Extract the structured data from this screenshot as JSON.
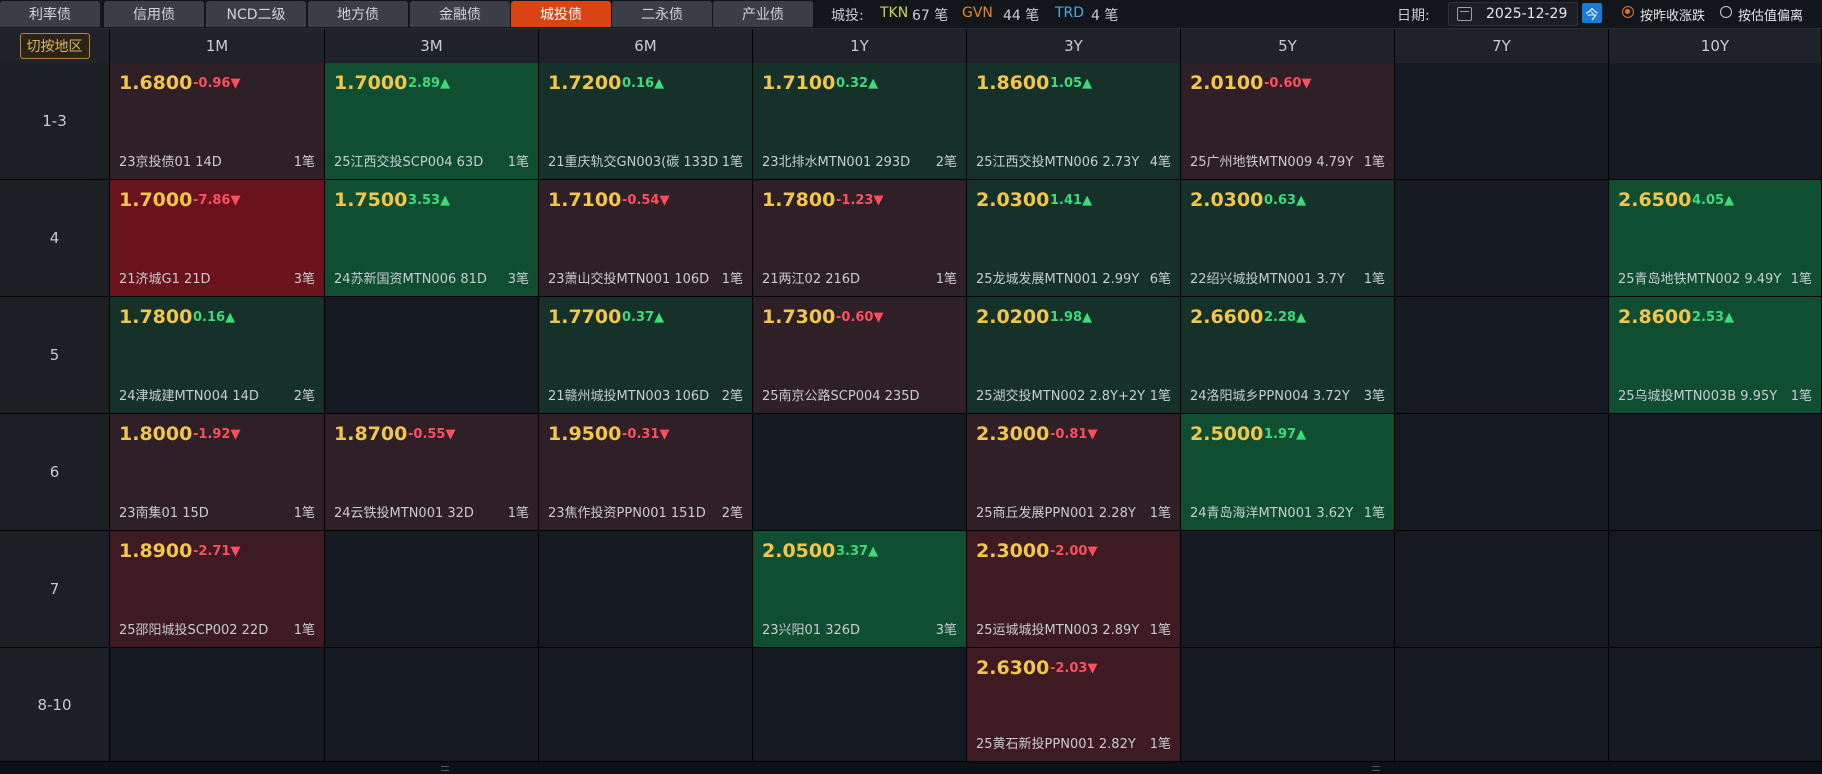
{
  "tabs": [
    {
      "label": "利率债",
      "active": false
    },
    {
      "label": "信用债",
      "active": false
    },
    {
      "label": "NCD二级",
      "active": false
    },
    {
      "label": "地方债",
      "active": false
    },
    {
      "label": "金融债",
      "active": false
    },
    {
      "label": "城投债",
      "active": true
    },
    {
      "label": "二永债",
      "active": false
    },
    {
      "label": "产业债",
      "active": false
    }
  ],
  "stats": {
    "label": "城投:",
    "items": [
      {
        "code": "TKN",
        "count": "67 笔",
        "color": "#c9d94a"
      },
      {
        "code": "GVN",
        "count": "44 笔",
        "color": "#e8842c"
      },
      {
        "code": "TRD",
        "count": "4 笔",
        "color": "#4aa8e8"
      }
    ]
  },
  "date": {
    "label": "日期:",
    "value": "2025-12-29",
    "today": "今"
  },
  "radios": [
    {
      "label": "按昨收涨跌",
      "selected": true
    },
    {
      "label": "按估值偏离",
      "selected": false
    }
  ],
  "region_button": "切按地区",
  "columns": [
    "1M",
    "3M",
    "6M",
    "1Y",
    "3Y",
    "5Y",
    "7Y",
    "10Y"
  ],
  "rows": [
    {
      "label": "1-3",
      "cells": [
        {
          "yield": "1.6800",
          "change": "-0.96▼",
          "dir": "down",
          "bond": "23京投债01 14D",
          "count": "1笔",
          "shade": "r1"
        },
        {
          "yield": "1.7000",
          "change": "2.89▲",
          "dir": "up",
          "bond": "25江西交投SCP004 63D",
          "count": "1笔",
          "shade": "g2"
        },
        {
          "yield": "1.7200",
          "change": "0.16▲",
          "dir": "up",
          "bond": "21重庆轨交GN003(碳 133D",
          "count": "1笔",
          "shade": "g1"
        },
        {
          "yield": "1.7100",
          "change": "0.32▲",
          "dir": "up",
          "bond": "23北排水MTN001 293D",
          "count": "2笔",
          "shade": "g1"
        },
        {
          "yield": "1.8600",
          "change": "1.05▲",
          "dir": "up",
          "bond": "25江西交投MTN006 2.73Y",
          "count": "4笔",
          "shade": "g1"
        },
        {
          "yield": "2.0100",
          "change": "-0.60▼",
          "dir": "down",
          "bond": "25广州地铁MTN009 4.79Y",
          "count": "1笔",
          "shade": "r1"
        },
        null,
        null
      ]
    },
    {
      "label": "4",
      "cells": [
        {
          "yield": "1.7000",
          "change": "-7.86▼",
          "dir": "down",
          "bond": "21济城G1 21D",
          "count": "3笔",
          "shade": "r3"
        },
        {
          "yield": "1.7500",
          "change": "3.53▲",
          "dir": "up",
          "bond": "24苏新国资MTN006 81D",
          "count": "3笔",
          "shade": "g2"
        },
        {
          "yield": "1.7100",
          "change": "-0.54▼",
          "dir": "down",
          "bond": "23萧山交投MTN001 106D",
          "count": "1笔",
          "shade": "r1"
        },
        {
          "yield": "1.7800",
          "change": "-1.23▼",
          "dir": "down",
          "bond": "21两江02 216D",
          "count": "1笔",
          "shade": "r1"
        },
        {
          "yield": "2.0300",
          "change": "1.41▲",
          "dir": "up",
          "bond": "25龙城发展MTN001 2.99Y",
          "count": "6笔",
          "shade": "g1"
        },
        {
          "yield": "2.0300",
          "change": "0.63▲",
          "dir": "up",
          "bond": "22绍兴城投MTN001 3.7Y",
          "count": "1笔",
          "shade": "g1"
        },
        null,
        {
          "yield": "2.6500",
          "change": "4.05▲",
          "dir": "up",
          "bond": "25青岛地铁MTN002 9.49Y",
          "count": "1笔",
          "shade": "g2"
        }
      ]
    },
    {
      "label": "5",
      "cells": [
        {
          "yield": "1.7800",
          "change": "0.16▲",
          "dir": "up",
          "bond": "24津城建MTN004 14D",
          "count": "2笔",
          "shade": "g1"
        },
        null,
        {
          "yield": "1.7700",
          "change": "0.37▲",
          "dir": "up",
          "bond": "21赣州城投MTN003 106D",
          "count": "2笔",
          "shade": "g1"
        },
        {
          "yield": "1.7300",
          "change": "-0.60▼",
          "dir": "down",
          "bond": "25南京公路SCP004 235D",
          "count": "",
          "shade": "r1"
        },
        {
          "yield": "2.0200",
          "change": "1.98▲",
          "dir": "up",
          "bond": "25湖交投MTN002 2.8Y+2Y",
          "count": "1笔",
          "shade": "g1"
        },
        {
          "yield": "2.6600",
          "change": "2.28▲",
          "dir": "up",
          "bond": "24洛阳城乡PPN004 3.72Y",
          "count": "3笔",
          "shade": "g1"
        },
        null,
        {
          "yield": "2.8600",
          "change": "2.53▲",
          "dir": "up",
          "bond": "25乌城投MTN003B 9.95Y",
          "count": "1笔",
          "shade": "g2"
        }
      ]
    },
    {
      "label": "6",
      "cells": [
        {
          "yield": "1.8000",
          "change": "-1.92▼",
          "dir": "down",
          "bond": "23南集01 15D",
          "count": "1笔",
          "shade": "r1"
        },
        {
          "yield": "1.8700",
          "change": "-0.55▼",
          "dir": "down",
          "bond": "24云铁投MTN001 32D",
          "count": "1笔",
          "shade": "r1"
        },
        {
          "yield": "1.9500",
          "change": "-0.31▼",
          "dir": "down",
          "bond": "23焦作投资PPN001 151D",
          "count": "2笔",
          "shade": "r1"
        },
        null,
        {
          "yield": "2.3000",
          "change": "-0.81▼",
          "dir": "down",
          "bond": "25商丘发展PPN001 2.28Y",
          "count": "1笔",
          "shade": "r1"
        },
        {
          "yield": "2.5000",
          "change": "1.97▲",
          "dir": "up",
          "bond": "24青岛海洋MTN001 3.62Y",
          "count": "1笔",
          "shade": "g2"
        },
        null,
        null
      ]
    },
    {
      "label": "7",
      "cells": [
        {
          "yield": "1.8900",
          "change": "-2.71▼",
          "dir": "down",
          "bond": "25邵阳城投SCP002 22D",
          "count": "1笔",
          "shade": "r2"
        },
        null,
        null,
        {
          "yield": "2.0500",
          "change": "3.37▲",
          "dir": "up",
          "bond": "23兴阳01 326D",
          "count": "3笔",
          "shade": "g2"
        },
        {
          "yield": "2.3000",
          "change": "-2.00▼",
          "dir": "down",
          "bond": "25运城城投MTN003 2.89Y",
          "count": "1笔",
          "shade": "r2"
        },
        null,
        null,
        null
      ]
    },
    {
      "label": "8-10",
      "cells": [
        null,
        null,
        null,
        null,
        {
          "yield": "2.6300",
          "change": "-2.03▼",
          "dir": "down",
          "bond": "25黄石新投PPN001 2.82Y",
          "count": "1笔",
          "shade": "r2"
        },
        null,
        null,
        null
      ]
    }
  ]
}
